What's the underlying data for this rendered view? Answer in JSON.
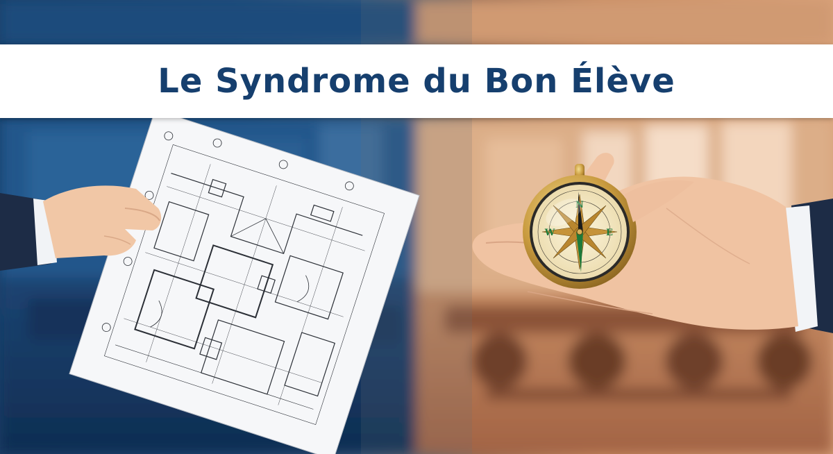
{
  "title": "Le Syndrome du Bon Élève",
  "colors": {
    "title_text": "#163f6e",
    "title_band": "#ffffff",
    "left_tone": "#1d4a78",
    "right_tone": "#c98c62"
  },
  "illustration": {
    "left_subject": "hand-holding-blueprint",
    "right_subject": "hand-holding-compass",
    "compass_letters": {
      "north": "N",
      "east": "E",
      "west": "W"
    }
  }
}
